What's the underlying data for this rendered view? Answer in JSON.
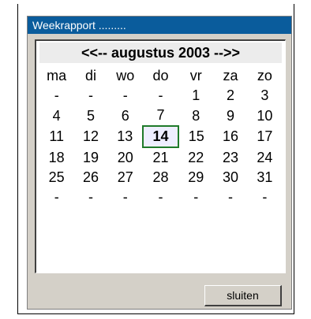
{
  "window": {
    "title": "Weekrapport ........."
  },
  "calendar": {
    "prev": "<<--",
    "month_label": "augustus 2003",
    "next": "-->>",
    "weekdays": [
      "ma",
      "di",
      "wo",
      "do",
      "vr",
      "za",
      "zo"
    ],
    "weeks": [
      [
        "-",
        "-",
        "-",
        "-",
        "1",
        "2",
        "3"
      ],
      [
        "4",
        "5",
        "6",
        "7",
        "8",
        "9",
        "10"
      ],
      [
        "11",
        "12",
        "13",
        "14",
        "15",
        "16",
        "17"
      ],
      [
        "18",
        "19",
        "20",
        "21",
        "22",
        "23",
        "24"
      ],
      [
        "25",
        "26",
        "27",
        "28",
        "29",
        "30",
        "31"
      ],
      [
        "-",
        "-",
        "-",
        "-",
        "-",
        "-",
        "-"
      ]
    ],
    "today": "14"
  },
  "buttons": {
    "close_label": "sluiten"
  },
  "colors": {
    "titlebar": "#0a5c9c",
    "today_border": "#1f7a2a",
    "dialog_bg": "#d4d0c8"
  }
}
